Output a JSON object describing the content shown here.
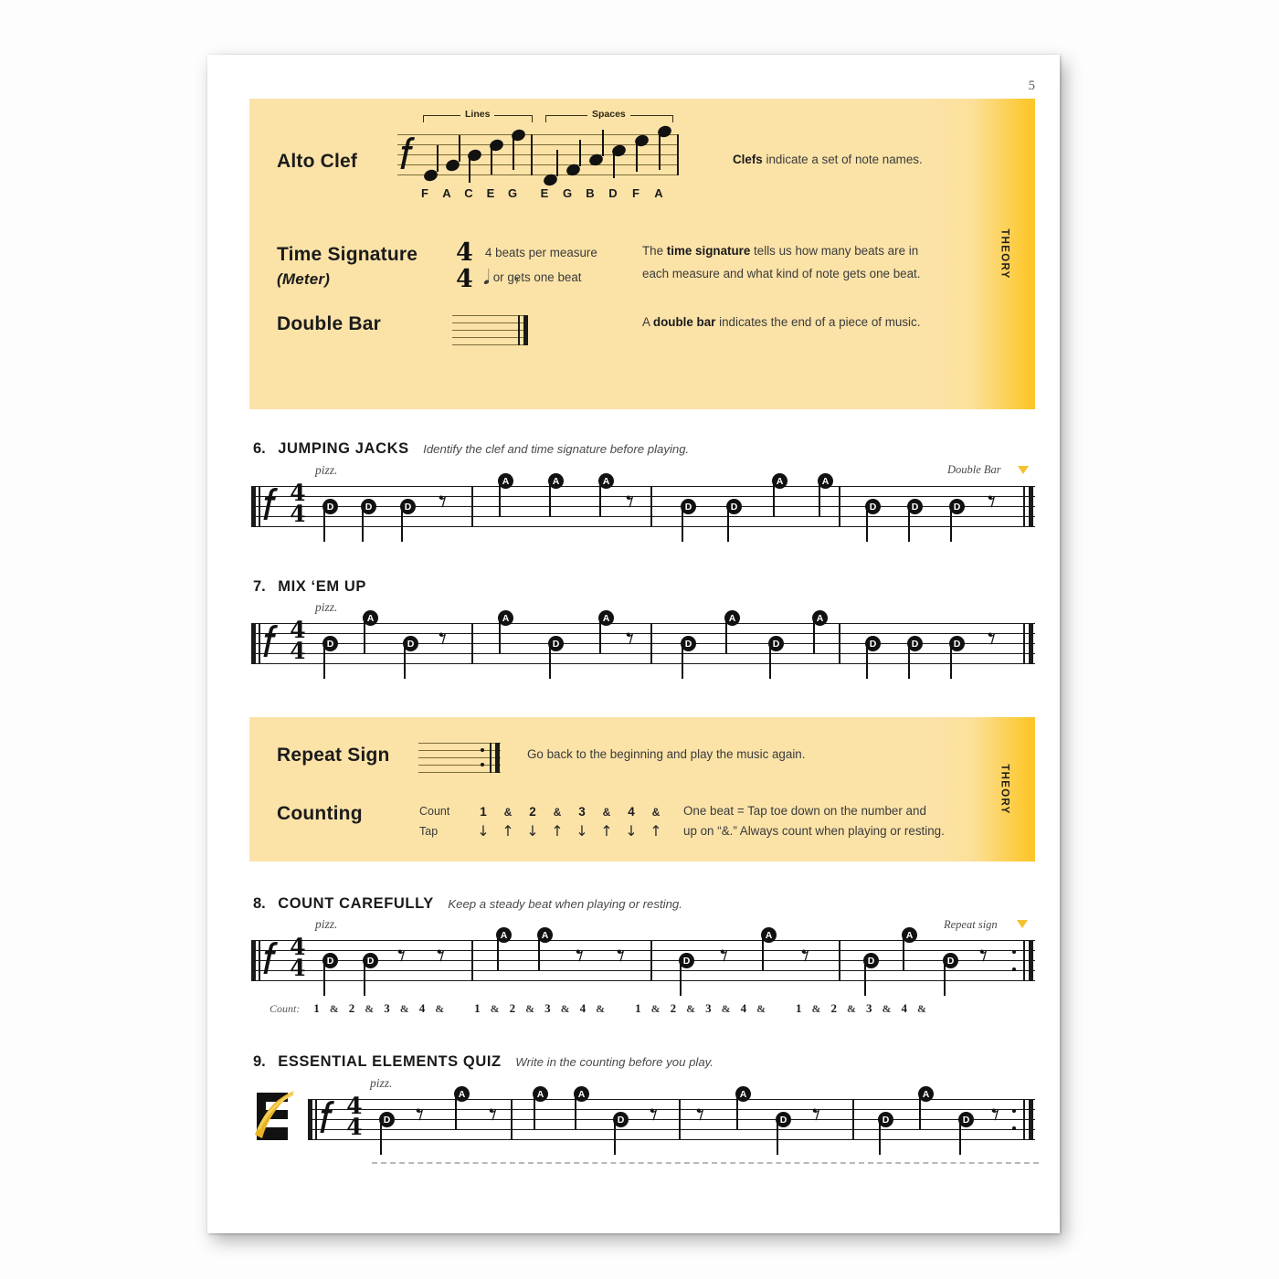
{
  "page": {
    "number": "5",
    "accent_color": "#fdc82f",
    "box_color": "#fbe3a8"
  },
  "theory_box_1": {
    "tab_label": "THEORY",
    "rows": [
      {
        "term": "Alto Clef",
        "description_html": "Clefs indicate a set of note names.",
        "description_bold": "Clefs",
        "description_rest": " indicate a set of note names."
      },
      {
        "term": "Time Signature",
        "term_sub": "(Meter)",
        "ts_line1": "4 beats per measure",
        "ts_line2": "or   gets one beat",
        "ts_line2_prefix": "",
        "ts_top": "4",
        "ts_bottom": "4",
        "description_prefix": "The ",
        "description_bold": "time signature",
        "description_rest": " tells us how many beats are in each measure and what kind of note gets one beat."
      },
      {
        "term": "Double Bar",
        "description_prefix": "A ",
        "description_bold": "double bar",
        "description_rest": " indicates the end of a piece of music."
      }
    ],
    "clef_diagram": {
      "bracket_lines_label": "Lines",
      "bracket_spaces_label": "Spaces",
      "line_notes": [
        "F",
        "A",
        "C",
        "E",
        "G"
      ],
      "space_notes": [
        "E",
        "G",
        "B",
        "D",
        "F",
        "A"
      ]
    }
  },
  "theory_box_2": {
    "tab_label": "THEORY",
    "rows": [
      {
        "term": "Repeat Sign",
        "description": "Go back to the beginning and play the music again."
      },
      {
        "term": "Counting",
        "count_label": "Count",
        "tap_label": "Tap",
        "counts": [
          "1",
          "&",
          "2",
          "&",
          "3",
          "&",
          "4",
          "&"
        ],
        "taps": [
          "↓",
          "↑",
          "↓",
          "↑",
          "↓",
          "↑",
          "↓",
          "↑"
        ],
        "description_line1": "One beat = Tap toe down on the number and",
        "description_line2": "up on “&.”  Always count when playing or resting."
      }
    ]
  },
  "exercises": [
    {
      "number": "6.",
      "title": "JUMPING JACKS",
      "subtitle": "Identify the clef and time signature before playing.",
      "articulation": "pizz.",
      "annotation": "Double Bar",
      "time_signature_top": "4",
      "time_signature_bottom": "4",
      "measures": [
        [
          "D",
          "D",
          "D",
          "rest"
        ],
        [
          "A",
          "A",
          "A",
          "rest"
        ],
        [
          "D",
          "D",
          "A",
          "A"
        ],
        [
          "D",
          "D",
          "D",
          "rest"
        ]
      ],
      "ending": "double-bar"
    },
    {
      "number": "7.",
      "title": "MIX ‘EM UP",
      "subtitle": "",
      "articulation": "pizz.",
      "annotation": "",
      "time_signature_top": "4",
      "time_signature_bottom": "4",
      "measures": [
        [
          "D",
          "A",
          "D",
          "rest"
        ],
        [
          "A",
          "D",
          "A",
          "rest"
        ],
        [
          "D",
          "A",
          "D",
          "A"
        ],
        [
          "D",
          "D",
          "D",
          "rest"
        ]
      ],
      "ending": "double-bar"
    },
    {
      "number": "8.",
      "title": "COUNT CAREFULLY",
      "subtitle": "Keep a steady beat when playing or resting.",
      "articulation": "pizz.",
      "annotation": "Repeat sign",
      "time_signature_top": "4",
      "time_signature_bottom": "4",
      "measures": [
        [
          "D",
          "D",
          "rest",
          "rest"
        ],
        [
          "A",
          "A",
          "rest",
          "rest"
        ],
        [
          "D",
          "rest",
          "A",
          "rest"
        ],
        [
          "D",
          "A",
          "D",
          "rest"
        ]
      ],
      "ending": "repeat-sign",
      "count_row_label": "Count:",
      "count_row_measures": [
        [
          "1",
          "&",
          "2",
          "&",
          "3",
          "&",
          "4",
          "&"
        ],
        [
          "1",
          "&",
          "2",
          "&",
          "3",
          "&",
          "4",
          "&"
        ],
        [
          "1",
          "&",
          "2",
          "&",
          "3",
          "&",
          "4",
          "&"
        ],
        [
          "1",
          "&",
          "2",
          "&",
          "3",
          "&",
          "4",
          "&"
        ]
      ]
    },
    {
      "number": "9.",
      "title": "ESSENTIAL ELEMENTS QUIZ",
      "subtitle": "Write in the counting before you play.",
      "articulation": "pizz.",
      "annotation": "",
      "logo": "ee-logo",
      "time_signature_top": "4",
      "time_signature_bottom": "4",
      "measures": [
        [
          "D",
          "rest",
          "A",
          "rest"
        ],
        [
          "A",
          "A",
          "D",
          "rest"
        ],
        [
          "rest",
          "A",
          "D",
          "rest"
        ],
        [
          "rest",
          "D",
          "A",
          "D"
        ]
      ],
      "ending": "repeat-sign"
    }
  ]
}
